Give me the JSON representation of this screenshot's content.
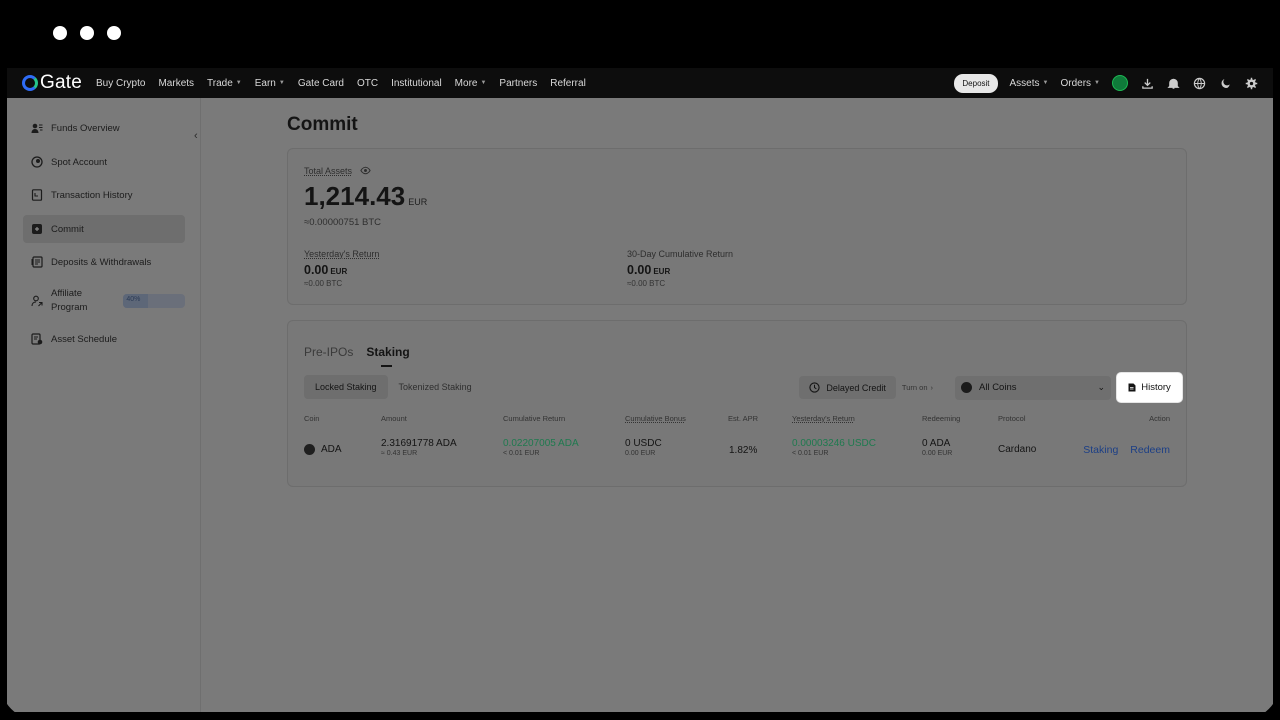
{
  "nav": {
    "brand": "Gate",
    "items": [
      {
        "label": "Buy Crypto",
        "caret": false
      },
      {
        "label": "Markets",
        "caret": false
      },
      {
        "label": "Trade",
        "caret": true
      },
      {
        "label": "Earn",
        "caret": true
      },
      {
        "label": "Gate Card",
        "caret": false
      },
      {
        "label": "OTC",
        "caret": false
      },
      {
        "label": "Institutional",
        "caret": false
      },
      {
        "label": "More",
        "caret": true
      },
      {
        "label": "Partners",
        "caret": false
      },
      {
        "label": "Referral",
        "caret": false
      }
    ],
    "deposit": "Deposit",
    "assets": "Assets",
    "orders": "Orders",
    "icons": [
      "download-icon",
      "bell-icon",
      "globe-icon",
      "moon-icon",
      "settings-icon"
    ]
  },
  "sidebar": {
    "items": [
      {
        "label": "Funds Overview",
        "icon": "funds-overview-icon"
      },
      {
        "label": "Spot Account",
        "icon": "spot-account-icon"
      },
      {
        "label": "Transaction History",
        "icon": "transaction-history-icon"
      },
      {
        "label": "Commit",
        "icon": "commit-icon",
        "active": true
      },
      {
        "label": "Deposits & Withdrawals",
        "icon": "deposits-withdrawals-icon"
      },
      {
        "label": "Affiliate Program",
        "icon": "affiliate-icon",
        "progress": "40%",
        "progress_value": 0.4
      },
      {
        "label": "Asset Schedule",
        "icon": "asset-schedule-icon"
      }
    ]
  },
  "page": {
    "title": "Commit"
  },
  "summary": {
    "total_label": "Total Assets",
    "total_value": "1,214.43",
    "total_currency": "EUR",
    "total_btc": "≈0.00000751 BTC",
    "yesterday_label": "Yesterday's Return",
    "yesterday_value": "0.00",
    "yesterday_currency": "EUR",
    "yesterday_btc": "≈0.00 BTC",
    "cumulative_label": "30-Day Cumulative Return",
    "cumulative_value": "0.00",
    "cumulative_currency": "EUR",
    "cumulative_btc": "≈0.00 BTC"
  },
  "tabs": [
    "Pre-IPOs",
    "Staking"
  ],
  "subtabs": [
    "Locked Staking",
    "Tokenized Staking"
  ],
  "filters": {
    "delayed_credit": "Delayed Credit",
    "turn_on": "Turn on",
    "all_coins": "All Coins",
    "history": "History"
  },
  "table": {
    "headers": [
      "Coin",
      "Amount",
      "Cumulative Return",
      "Cumulative Bonus",
      "Est. APR",
      "Yesterday's Return",
      "Redeeming",
      "Protocol",
      "Action"
    ],
    "rows": [
      {
        "coin": "ADA",
        "amount": "2.31691778 ADA",
        "amount_sub": "≈ 0.43 EUR",
        "cum_return": "0.02207005 ADA",
        "cum_return_sub": "< 0.01 EUR",
        "cum_bonus": "0 USDC",
        "cum_bonus_sub": "0.00 EUR",
        "apr": "1.82%",
        "yesterday": "0.00003246 USDC",
        "yesterday_sub": "< 0.01 EUR",
        "redeeming": "0 ADA",
        "redeeming_sub": "0.00 EUR",
        "protocol": "Cardano",
        "action_staking": "Staking",
        "action_redeem": "Redeem"
      }
    ]
  }
}
